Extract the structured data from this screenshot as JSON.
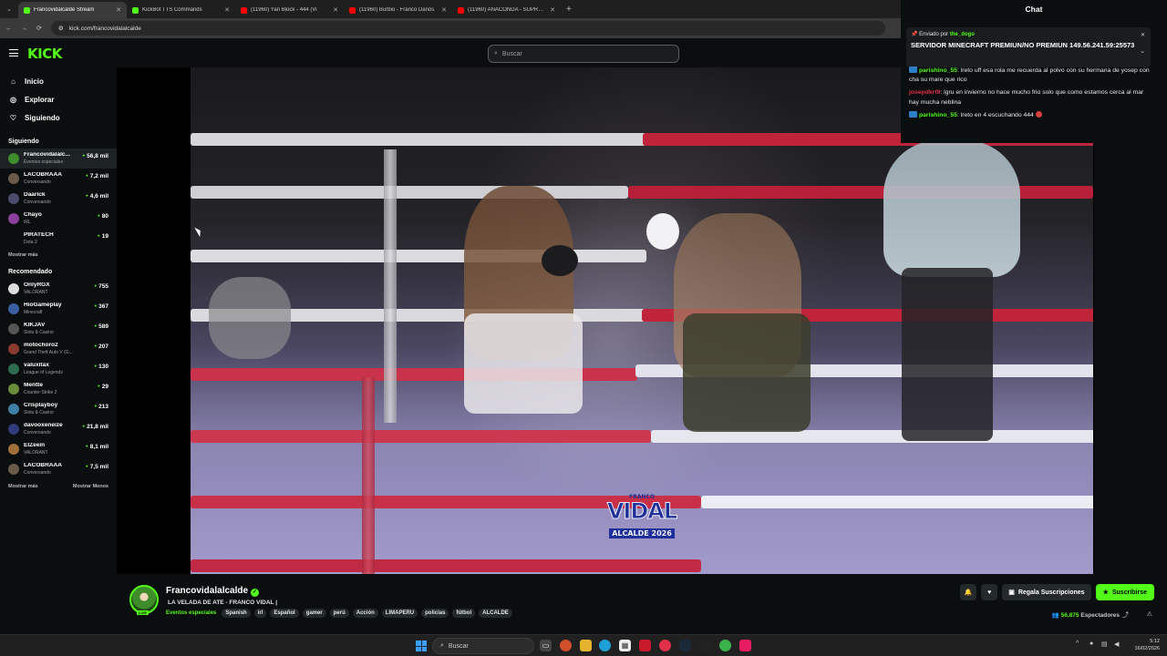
{
  "browser": {
    "tabs": [
      {
        "title": "Francovidalcalde Stream",
        "active": true,
        "color": "#53fc18"
      },
      {
        "title": "KickBot TTS Commands",
        "active": false,
        "color": "#53fc18"
      },
      {
        "title": "(11960) Yan Block - 444 (Vi",
        "active": false,
        "color": "#ff0000"
      },
      {
        "title": "(11960) Burbio - Franco Danós",
        "active": false,
        "color": "#ff0000"
      },
      {
        "title": "(11960) ANACONDA - SUPREM",
        "active": false,
        "color": "#ff0000"
      }
    ],
    "url": "kick.com/francovidalalcalde"
  },
  "kick": {
    "logo": "KICK",
    "search_placeholder": "Buscar"
  },
  "sidebar": {
    "nav": [
      {
        "label": "Inicio",
        "icon": "home-icon",
        "glyph": "⌂"
      },
      {
        "label": "Explorar",
        "icon": "compass-icon",
        "glyph": "◎"
      },
      {
        "label": "Siguiendo",
        "icon": "heart-icon",
        "glyph": "♡"
      }
    ],
    "following_title": "Siguiendo",
    "following": [
      {
        "name": "Francovidalalc...",
        "category": "Eventos especiales",
        "viewers": "56,8 mil",
        "color": "#3f8c2d"
      },
      {
        "name": "LACOBRAAA",
        "category": "Conversando",
        "viewers": "7,2 mil",
        "color": "#6b5a4a"
      },
      {
        "name": "Daarick",
        "category": "Conversando",
        "viewers": "4,6 mil",
        "color": "#4a4a6b"
      },
      {
        "name": "Chayo",
        "category": "IRL",
        "viewers": "80",
        "color": "#8a3f9c"
      },
      {
        "name": "PIRATECH",
        "category": "Dota 2",
        "viewers": "19",
        "color": "#0b0e0f"
      }
    ],
    "show_more": "Mostrar más",
    "recommended_title": "Recomendado",
    "recommended": [
      {
        "name": "OnlyRGX",
        "category": "VALORANT",
        "viewers": "755",
        "color": "#ddd"
      },
      {
        "name": "HioGameplay",
        "category": "Minecraft",
        "viewers": "367",
        "color": "#3a5fa0"
      },
      {
        "name": "KIKJAV",
        "category": "Slots & Casino",
        "viewers": "589",
        "color": "#555"
      },
      {
        "name": "motochoro2",
        "category": "Grand Theft Auto V (G...",
        "viewers": "207",
        "color": "#8b3a2f"
      },
      {
        "name": "valuxitax",
        "category": "League of Legends",
        "viewers": "130",
        "color": "#2f6b4f"
      },
      {
        "name": "Mentte",
        "category": "Counter-Strike 2",
        "viewers": "29",
        "color": "#6a8c3a"
      },
      {
        "name": "Crisplayboy",
        "category": "Slots & Casino",
        "viewers": "213",
        "color": "#3f7fa6"
      },
      {
        "name": "davooxeneize",
        "category": "Conversando",
        "viewers": "21,8 mil",
        "color": "#2f3b7a"
      },
      {
        "name": "ElZeein",
        "category": "VALORANT",
        "viewers": "8,1 mil",
        "color": "#a0703a"
      },
      {
        "name": "LACOBRAAA",
        "category": "Conversando",
        "viewers": "7,5 mil",
        "color": "#6b5a4a"
      }
    ],
    "show_more_2": "Mostrar más",
    "show_less": "Mostrar Menos"
  },
  "video": {
    "watermark_top": "FRANCO",
    "watermark_name": "VIDAL",
    "watermark_sub": "ALCALDE 2026"
  },
  "chat": {
    "title": "Chat",
    "pinned_by_label": "Enviado por",
    "pinned_by_user": "the_dogo",
    "pinned_message": "SERVIDOR MINECRAFT PREMIUN/NO PREMIUN 149.56.241.59:25573",
    "messages": [
      {
        "user": "parishino_55",
        "text": "lreto uff esa rola me recuerda al polvo con su hermana de yosep con cha su mare que rico",
        "color": "#53fc18",
        "badge": true
      },
      {
        "user": "josepdkrt9",
        "text": "lgru en invierno no hace mucho frio solo que como estamos cerca al mar hay mucha neblina",
        "color": "#e0304a",
        "badge": false
      },
      {
        "user": "parishino_55",
        "text": "lreto en 4 escuchando 444",
        "color": "#53fc18",
        "badge": true
      }
    ]
  },
  "stream": {
    "streamer": "Francovidalalcalde",
    "title": "LA VELADA DE ATE - FRANCO VIDAL |",
    "category": "Eventos especiales",
    "tags": [
      "Spanish",
      "irl",
      "Español",
      "gamer",
      "perú",
      "Acción",
      "LIMAPERU",
      "policias",
      "fútbol",
      "ALCALDE"
    ],
    "gift_label": "Regala Suscripciones",
    "subscribe_label": "Suscribirse",
    "viewers": "56,875",
    "viewers_label": "Espectadores",
    "live_label": "LIVE"
  },
  "taskbar": {
    "search": "Buscar",
    "time": "5:12",
    "date": "16/02/2026"
  }
}
